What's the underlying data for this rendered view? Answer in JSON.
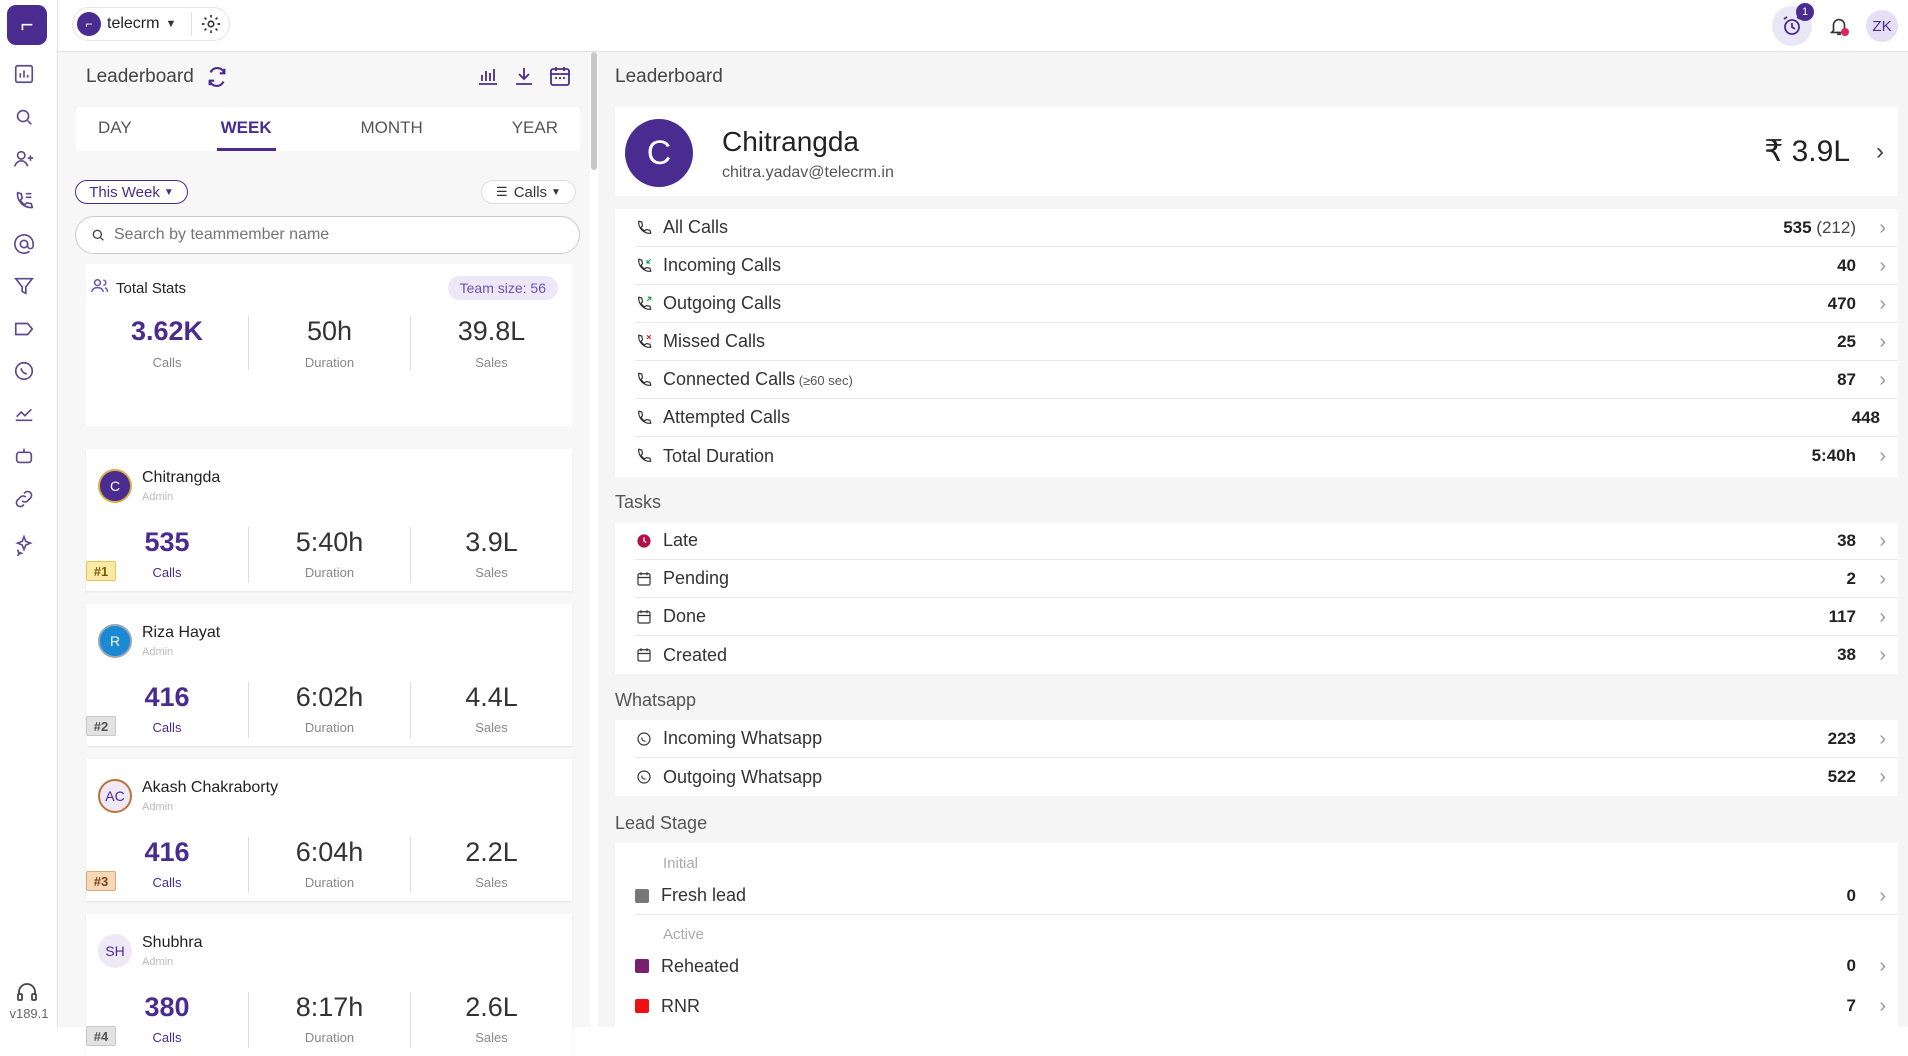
{
  "app": {
    "workspace": "telecrm",
    "version": "v189.1",
    "user_initials": "ZK",
    "alarm_count": "1",
    "brand_color": "#4a2b8f"
  },
  "left": {
    "title": "Leaderboard",
    "tabs": [
      "DAY",
      "WEEK",
      "MONTH",
      "YEAR"
    ],
    "active_tab": "WEEK",
    "period_filter": "This Week",
    "metric_filter": "Calls",
    "search_placeholder": "Search by teammember name",
    "total_stats": {
      "label": "Total Stats",
      "team_size": "Team size: 56",
      "calls": "3.62K",
      "calls_label": "Calls",
      "duration": "50h",
      "duration_label": "Duration",
      "sales": "39.8L",
      "sales_label": "Sales"
    },
    "members": [
      {
        "initials": "C",
        "name": "Chitrangda",
        "role": "Admin",
        "calls": "535",
        "duration": "5:40h",
        "sales": "3.9L",
        "rank": "#1"
      },
      {
        "initials": "R",
        "name": "Riza Hayat",
        "role": "Admin",
        "calls": "416",
        "duration": "6:02h",
        "sales": "4.4L",
        "rank": "#2"
      },
      {
        "initials": "AC",
        "name": "Akash Chakraborty",
        "role": "Admin",
        "calls": "416",
        "duration": "6:04h",
        "sales": "2.2L",
        "rank": "#3"
      },
      {
        "initials": "SH",
        "name": "Shubhra",
        "role": "Admin",
        "calls": "380",
        "duration": "8:17h",
        "sales": "2.6L",
        "rank": "#4"
      }
    ],
    "calls_label": "Calls",
    "duration_label": "Duration",
    "sales_label": "Sales"
  },
  "right": {
    "title": "Leaderboard",
    "profile": {
      "initial": "C",
      "name": "Chitrangda",
      "email": "chitra.yadav@telecrm.in",
      "sales": "₹ 3.9L"
    },
    "calls": [
      {
        "label": "All Calls",
        "value": "535",
        "extra": " (212)"
      },
      {
        "label": "Incoming Calls",
        "value": "40"
      },
      {
        "label": "Outgoing Calls",
        "value": "470"
      },
      {
        "label": "Missed Calls",
        "value": "25"
      },
      {
        "label": "Connected Calls",
        "suffix": " (≥60 sec)",
        "value": "87"
      },
      {
        "label": "Attempted Calls",
        "value": "448"
      },
      {
        "label": "Total Duration",
        "value": "5:40h"
      }
    ],
    "tasks_title": "Tasks",
    "tasks": [
      {
        "label": "Late",
        "value": "38"
      },
      {
        "label": "Pending",
        "value": "2"
      },
      {
        "label": "Done",
        "value": "117"
      },
      {
        "label": "Created",
        "value": "38"
      }
    ],
    "whatsapp_title": "Whatsapp",
    "whatsapp": [
      {
        "label": "Incoming Whatsapp",
        "value": "223"
      },
      {
        "label": "Outgoing Whatsapp",
        "value": "522"
      }
    ],
    "lead_title": "Lead Stage",
    "lead_groups": [
      {
        "group": "Initial",
        "items": [
          {
            "label": "Fresh lead",
            "value": "0",
            "color": "#777777"
          }
        ]
      },
      {
        "group": "Active",
        "items": [
          {
            "label": "Reheated",
            "value": "0",
            "color": "#7a1f6e"
          },
          {
            "label": "RNR",
            "value": "7",
            "color": "#ee1111"
          }
        ]
      }
    ]
  }
}
